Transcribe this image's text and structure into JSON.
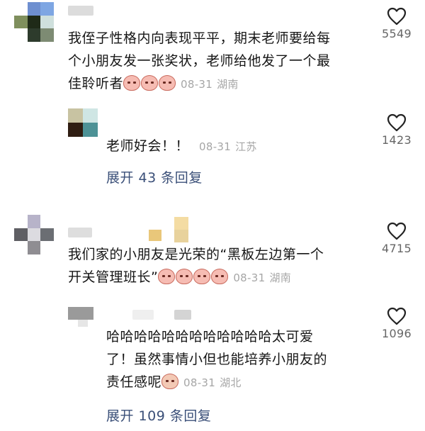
{
  "comments": [
    {
      "text_lines": [
        "我侄子性格内向表现平平，期末老师要给每",
        "个小朋友发一张奖状，老师给他发了一个最",
        "佳聆听者"
      ],
      "time": "08-31",
      "location": "湖南",
      "likes": "5549",
      "avatar_colors": [
        "#ffffff",
        "#6e8fd0",
        "#7ea6e3",
        "#7f8f5d",
        "#1f2a18",
        "#cfe0dd",
        "#ffffff",
        "#2d3b2c",
        "#7d8b73"
      ],
      "reply": {
        "text": "老师好会！！",
        "time": "08-31",
        "location": "江苏",
        "likes": "1423",
        "avatar_colors": [
          "#c8c3a2",
          "#cfe6e4",
          "#2f1d12",
          "#4d9296"
        ]
      },
      "expand_label": "展开 43 条回复"
    },
    {
      "text_lines": [
        "我们家的小朋友是光荣的“黑板左边第一个",
        "开关管理班长”"
      ],
      "time": "08-31",
      "location": "湖南",
      "likes": "4715",
      "avatar_colors": [
        "#ffffff",
        "#b7b3c9",
        "#ffffff",
        "#5f5f64",
        "#dcdbe0",
        "#6b6e73",
        "#ffffff",
        "#8f8d92",
        "#ffffff"
      ],
      "reply": {
        "text_lines": [
          "哈哈哈哈哈哈哈哈哈哈哈哈太可爱",
          "了！虽然事情小但也能培养小朋友的",
          "责任感呢"
        ],
        "time": "08-31",
        "location": "湖北",
        "likes": "1096"
      },
      "expand_label": "展开 109 条回复"
    }
  ],
  "icons": {
    "like": "heart-outline-icon",
    "emoji": "crying-face-emoji-icon"
  }
}
